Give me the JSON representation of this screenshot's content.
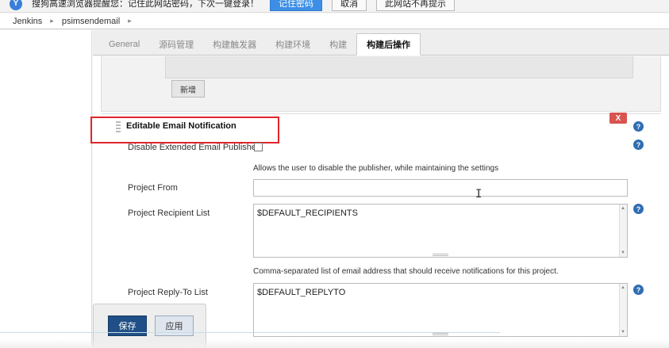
{
  "password_bar": {
    "logo_icon": "sogou-browser-icon",
    "logo_glyph": "Y",
    "message": "搜狗高速浏览器提醒您：记住此网站密码，下次一键登录！",
    "remember_label": "记住密码",
    "cancel_label": "取消",
    "never_label": "此网站不再提示"
  },
  "breadcrumb": {
    "items": [
      "Jenkins",
      "psimsendemail"
    ],
    "separator": "▸"
  },
  "tabs": [
    {
      "label": "General",
      "active": false
    },
    {
      "label": "源码管理",
      "active": false
    },
    {
      "label": "构建触发器",
      "active": false
    },
    {
      "label": "构建环境",
      "active": false
    },
    {
      "label": "构建",
      "active": false
    },
    {
      "label": "构建后操作",
      "active": true
    }
  ],
  "add_button_label": "新增",
  "section": {
    "title": "Editable Email Notification",
    "delete_label": "X",
    "help_glyph": "?",
    "highlight_color": "#e0262b"
  },
  "fields": {
    "disable_publisher": {
      "label": "Disable Extended Email Publisher",
      "checked": false,
      "description": "Allows the user to disable the publisher, while maintaining the settings"
    },
    "project_from": {
      "label": "Project From",
      "value": ""
    },
    "recipient_list": {
      "label": "Project Recipient List",
      "value": "$DEFAULT_RECIPIENTS",
      "description": "Comma-separated list of email address that should receive notifications for this project."
    },
    "reply_to": {
      "label": "Project Reply-To List",
      "value": "$DEFAULT_REPLYTO"
    }
  },
  "actions": {
    "save_label": "保存",
    "apply_label": "应用"
  },
  "colors": {
    "primary_button": "#1f4f86",
    "delete_button": "#d9534f",
    "help_icon": "#2f6db3",
    "browser_accent": "#3d8ee6"
  }
}
